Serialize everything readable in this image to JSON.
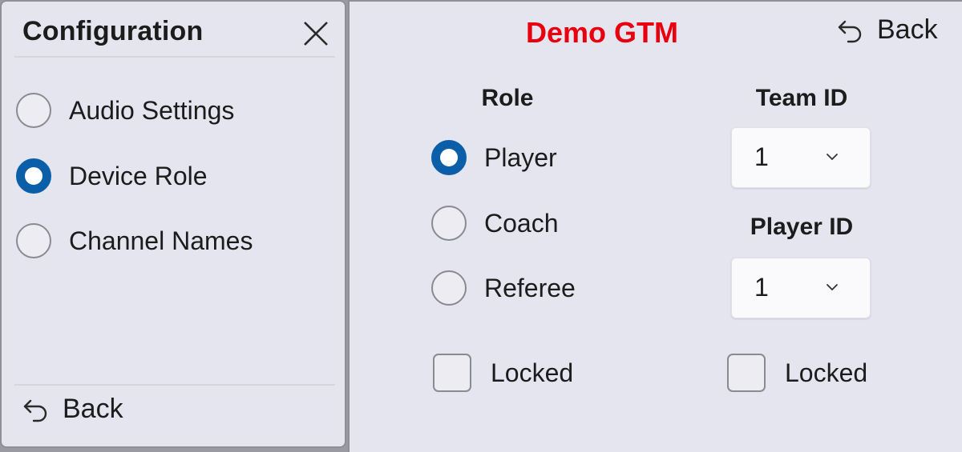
{
  "config_panel": {
    "title": "Configuration",
    "menu_items": [
      {
        "label": "Audio Settings",
        "selected": false
      },
      {
        "label": "Device Role",
        "selected": true
      },
      {
        "label": "Channel Names",
        "selected": false
      }
    ],
    "back_label": "Back"
  },
  "main_panel": {
    "title": "Demo GTM",
    "title_color": "#e8000f",
    "back_label": "Back",
    "role": {
      "heading": "Role",
      "options": [
        {
          "label": "Player",
          "selected": true
        },
        {
          "label": "Coach",
          "selected": false
        },
        {
          "label": "Referee",
          "selected": false
        }
      ],
      "locked_label": "Locked",
      "locked_checked": false
    },
    "team_id": {
      "heading": "Team ID",
      "value": "1"
    },
    "player_id": {
      "heading": "Player ID",
      "value": "1"
    },
    "id_locked_label": "Locked",
    "id_locked_checked": false
  },
  "colors": {
    "accent": "#0b5ea8",
    "panel_bg": "#e5e5ef"
  }
}
